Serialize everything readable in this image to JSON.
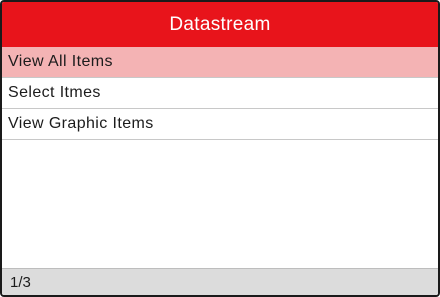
{
  "header": {
    "title": "Datastream"
  },
  "menu": {
    "items": [
      {
        "label": "View All Items",
        "selected": true
      },
      {
        "label": "Select Itmes",
        "selected": false
      },
      {
        "label": "View Graphic Items",
        "selected": false
      }
    ]
  },
  "status": {
    "page_indicator": "1/3"
  },
  "colors": {
    "header_bg": "#e8141b",
    "selected_bg": "#f4b3b4",
    "status_bg": "#dcdcdc"
  }
}
